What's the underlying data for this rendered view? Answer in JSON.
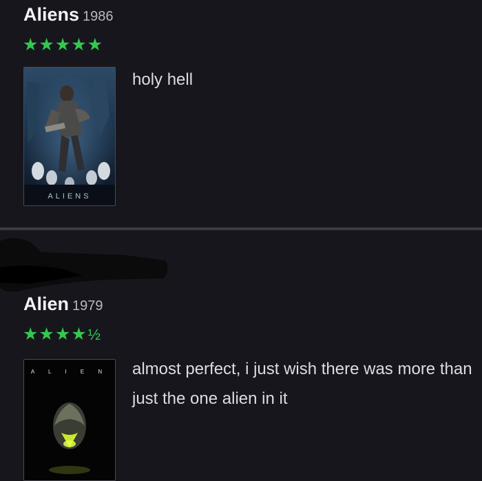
{
  "reviews": [
    {
      "title": "Aliens",
      "year": "1986",
      "rating": 5,
      "stars_display": "★★★★★",
      "half_display": "",
      "text": "holy hell",
      "poster_caption": "ALIENS"
    },
    {
      "title": "Alien",
      "year": "1979",
      "rating": 4.5,
      "stars_display": "★★★★",
      "half_display": "½",
      "text": "almost perfect, i just wish there was more than just the one alien in it",
      "poster_caption": "A L I E N"
    }
  ],
  "colors": {
    "background": "#17161d",
    "star": "#33c94f",
    "divider": "#3b3a46"
  }
}
